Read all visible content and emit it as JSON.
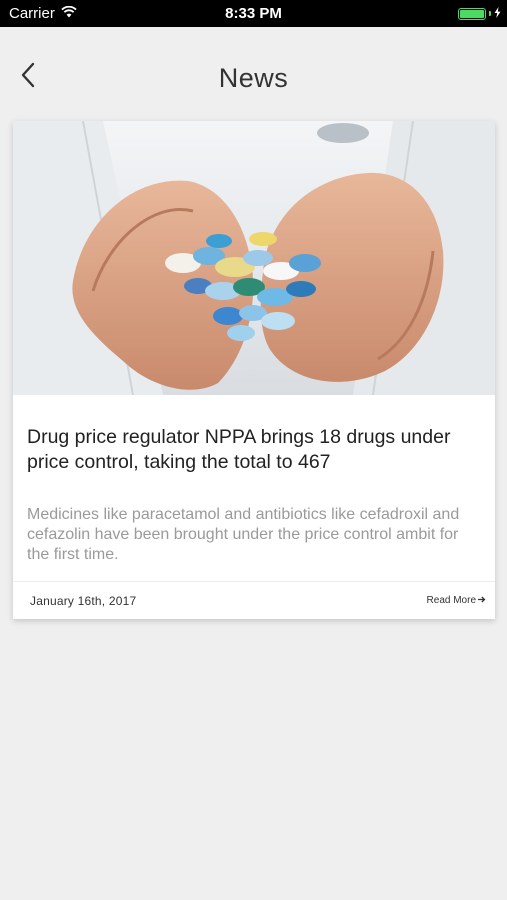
{
  "status_bar": {
    "carrier": "Carrier",
    "time": "8:33 PM",
    "battery_level": 1.0,
    "battery_color": "#4cd964"
  },
  "nav": {
    "title": "News",
    "back_icon": "chevron-left-icon"
  },
  "article": {
    "image_icon": "pills-in-hands-photo",
    "headline": "Drug price regulator NPPA brings 18 drugs under price control, taking the total to 467",
    "excerpt": "Medicines like paracetamol and antibiotics like cefadroxil and cefazolin have been brought under the price control ambit for the first time.",
    "date": "January 16th, 2017",
    "read_more": "Read More",
    "read_more_icon": "arrow-right-icon"
  }
}
